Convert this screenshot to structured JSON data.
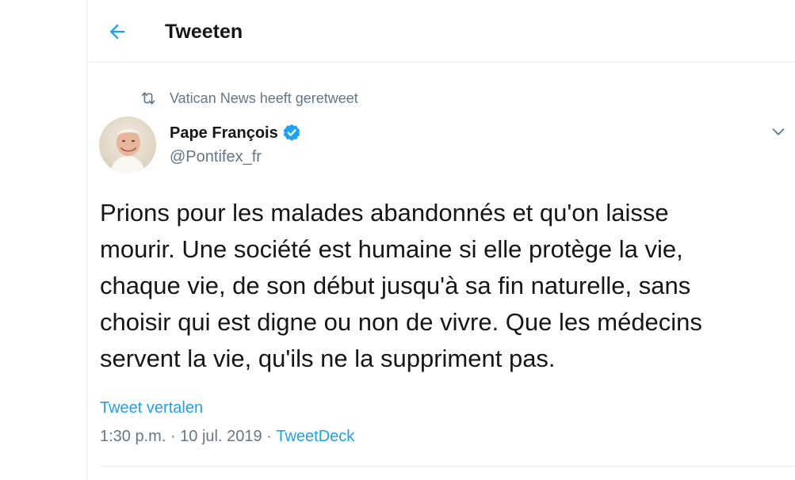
{
  "header": {
    "title": "Tweeten"
  },
  "retweet": {
    "text": "Vatican News heeft geretweet"
  },
  "author": {
    "name": "Pape François",
    "handle": "@Pontifex_fr"
  },
  "tweet": {
    "text": "Prions pour les malades abandonnés et qu'on laisse\nmourir. Une société est humaine si elle protège la vie,\nchaque vie, de son début jusqu'à sa fin naturelle, sans\nchoisir qui est digne ou non de vivre. Que les médecins\nservent la vie, qu'ils ne la suppriment pas."
  },
  "translate_label": "Tweet vertalen",
  "meta": {
    "time": "1:30 p.m.",
    "separator": " · ",
    "date": "10 jul. 2019",
    "separator2": " · ",
    "source": "TweetDeck"
  },
  "colors": {
    "accent": "#1da1f2",
    "text": "#14171a",
    "secondary": "#657786",
    "border": "#e6ecf0"
  },
  "icons": {
    "back": "arrow-left-icon",
    "retweet": "retweet-icon",
    "verified": "verified-badge-icon",
    "caret": "chevron-down-icon"
  }
}
